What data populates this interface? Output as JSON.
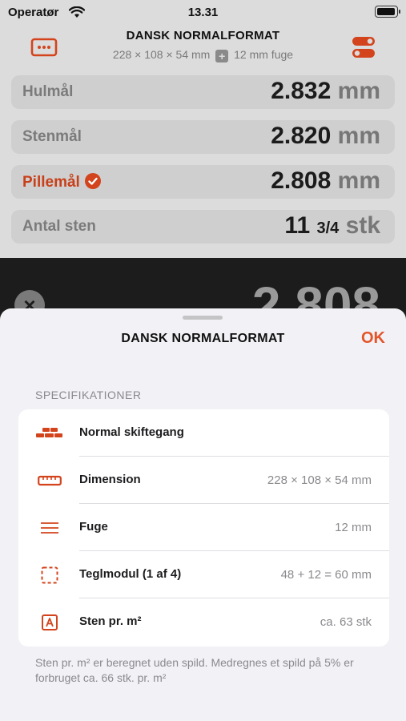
{
  "status_bar": {
    "carrier": "Operatør",
    "time": "13.31"
  },
  "app_header": {
    "title": "DANSK NORMALFORMAT",
    "dimensions": "228 × 108 × 54 mm",
    "plus_symbol": "+",
    "joint": "12 mm fuge",
    "left_icon": "ellipsis-box-icon",
    "right_icon": "toggles-icon"
  },
  "results": [
    {
      "label": "Hulmål",
      "value": "2.832",
      "unit": "mm"
    },
    {
      "label": "Stenmål",
      "value": "2.820",
      "unit": "mm"
    },
    {
      "label": "Pillemål",
      "value": "2.808",
      "unit": "mm"
    },
    {
      "label": "Antal sten",
      "value": "11",
      "fraction": "3/4",
      "unit": "stk"
    }
  ],
  "display": {
    "clear_symbol": "×",
    "value": "2.808"
  },
  "sheet": {
    "title": "DANSK NORMALFORMAT",
    "ok_label": "OK",
    "section_header": "SPECIFIKATIONER",
    "specs": [
      {
        "label": "Normal skiftegang",
        "value": "",
        "icon": "brick-bond-icon"
      },
      {
        "label": "Dimension",
        "value": "228 × 108 × 54 mm",
        "icon": "ruler-icon"
      },
      {
        "label": "Fuge",
        "value": "12 mm",
        "icon": "joint-lines-icon"
      },
      {
        "label": "Teglmodul (1 af 4)",
        "value": "48 + 12 = 60 mm",
        "icon": "dashed-square-icon"
      },
      {
        "label": "Sten pr. m²",
        "value": "ca. 63 stk",
        "icon": "area-a-icon"
      }
    ],
    "footnote": "Sten pr. m² er beregnet uden spild. Medregnes et spild på 5% er forbruget ca. 66 stk. pr. m²"
  },
  "colors": {
    "accent": "#e4552b",
    "active_label": "#c8401a",
    "sheet_bg": "#f2f2f6"
  }
}
